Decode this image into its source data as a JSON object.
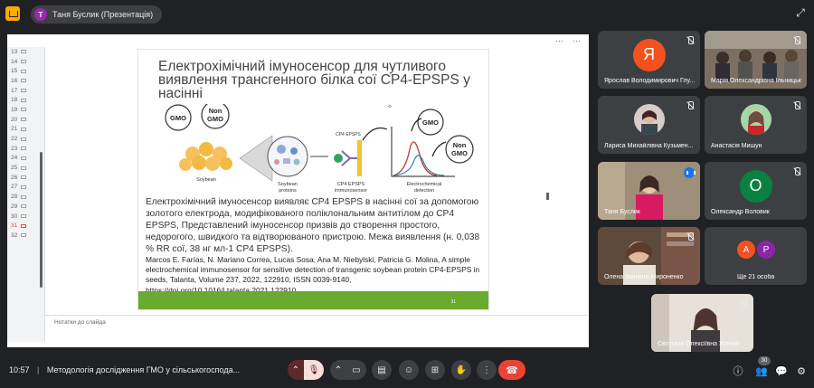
{
  "topbar": {
    "presenter_label": "Таня Буслик (Презентація)",
    "presenter_initial": "Т"
  },
  "slides_panel": {
    "numbers": [
      "13",
      "14",
      "15",
      "16",
      "17",
      "18",
      "19",
      "20",
      "21",
      "22",
      "23",
      "24",
      "25",
      "26",
      "27",
      "28",
      "29",
      "30",
      "31",
      "32"
    ],
    "active": "31"
  },
  "slide": {
    "title": "Електрохімічний імуносенсор для чутливого виявлення трансгенного білка сої CP4-EPSPS у насінні",
    "diagram": {
      "gmo": "GMO",
      "non": "Non",
      "gmo2": "GMO",
      "soybean": "Soybean",
      "soybean_proteins_1": "Soybean",
      "soybean_proteins_2": "proteins",
      "cp4_top": "CP4 EPSPS",
      "cp4_bottom_1": "CP4 EPSPS",
      "cp4_bottom_2": "immunosensor",
      "electro_1": "Electrochemical",
      "electro_2": "detection",
      "gmo_right": "GMO",
      "non_right": "Non",
      "gmo_right2": "GMO"
    },
    "body": "Електрохімічний імуносенсор виявляє CP4 EPSPS в насінні сої за допомогою золотого електрода, модифікованого поліклональним антитілом до CP4 EPSPS, Представлений імуносенсор призвів до створення простого, недорогого, швидкого та відтворюваного пристрою. Межа виявлення (н. 0,038 % RR сої, 38 нг мл-1 CP4 EPSPS).",
    "reference": "Marcos E. Farías, N. Mariano Correa, Lucas Sosa, Ana M. Niebylski, Patricia G. Molina, A simple electrochemical immunosensor for sensitive detection of transgenic soybean protein CP4-EPSPS in seeds, Talanta, Volume 237, 2022, 122910, ISSN 0039-9140, https://doi.org/10.1016/j.talanta.2021.122910.",
    "page_number": "31"
  },
  "notes_placeholder": "Нотатки до слайда",
  "participants": [
    {
      "name": "Ярослав Володимирович Глу...",
      "initial": "Я",
      "color": "#f4511e"
    },
    {
      "name": "Марія Олександрівна Ільницька"
    },
    {
      "name": "Лариса Михайлівна Кузьмен..."
    },
    {
      "name": "Анастасія Мишун"
    },
    {
      "name": "Таня Буслик"
    },
    {
      "name": "Олександр Воловик",
      "initial": "О",
      "color": "#0b8043"
    },
    {
      "name": "Олена Іванівна Мироненко"
    },
    {
      "name": "Ще 21 особа",
      "initials": [
        "А",
        "Р"
      ],
      "colors": [
        "#f4511e",
        "#8e24aa"
      ]
    },
    {
      "name": "Світлана Олексіївна Усенко"
    }
  ],
  "bottombar": {
    "time": "10:57",
    "meeting_title": "Методологія дослідження ГМО у сільськогоспода...",
    "participants_count": "30"
  }
}
